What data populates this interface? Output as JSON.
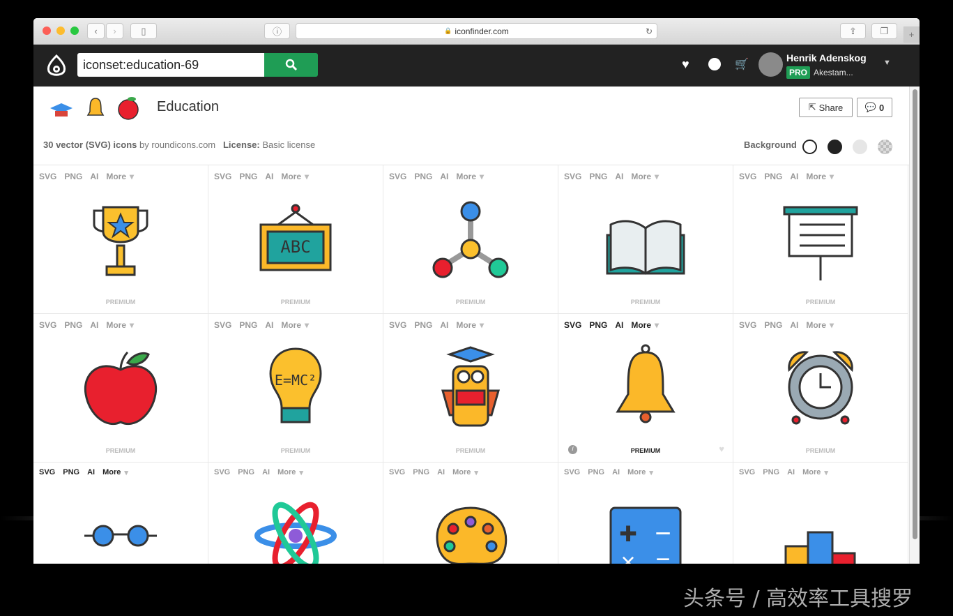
{
  "browser": {
    "url": "iconfinder.com"
  },
  "nav": {
    "search_value": "iconset:education-69",
    "user_name": "Henrik Adenskog",
    "badge": "PRO",
    "org": "Akestam..."
  },
  "iconset": {
    "title": "Education",
    "count_text": "30 vector (SVG) icons",
    "by_text": "by roundicons.com",
    "license_label": "License:",
    "license_value": "Basic license",
    "share_label": "Share",
    "comments_count": "0",
    "background_label": "Background"
  },
  "formats": [
    "SVG",
    "PNG",
    "AI",
    "More"
  ],
  "premium_label": "PREMIUM",
  "icons": [
    {
      "name": "trophy"
    },
    {
      "name": "chalkboard-abc"
    },
    {
      "name": "molecule"
    },
    {
      "name": "open-book"
    },
    {
      "name": "presentation-board"
    },
    {
      "name": "apple"
    },
    {
      "name": "lightbulb-emc2"
    },
    {
      "name": "owl-graduate"
    },
    {
      "name": "bell",
      "hover": true
    },
    {
      "name": "alarm-clock"
    },
    {
      "name": "glasses"
    },
    {
      "name": "atom"
    },
    {
      "name": "palette"
    },
    {
      "name": "calculator"
    },
    {
      "name": "podium"
    }
  ],
  "colors": {
    "accent": "#1f9d55",
    "navbar": "#222222"
  },
  "watermark": "头条号 / 高效率工具搜罗"
}
